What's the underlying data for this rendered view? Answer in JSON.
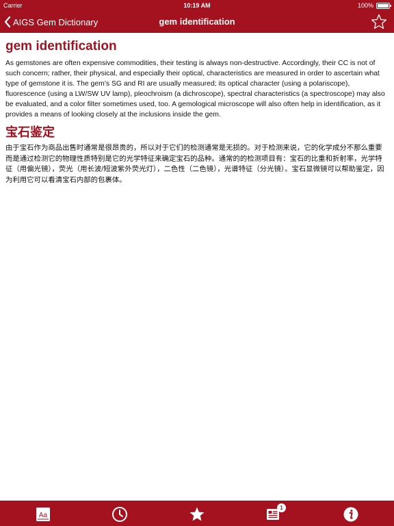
{
  "status_bar": {
    "carrier": "Carrier",
    "time": "10:19 AM",
    "battery": "100%"
  },
  "nav": {
    "back_label": "AIGS Gem Dictionary",
    "title": "gem identification",
    "favorite_icon": "star-outline-icon"
  },
  "entry": {
    "en_term": "gem identification",
    "en_definition": "As gemstones are often expensive commodities, their testing is always non-destructive. Accordingly, their CC is not of such concern; rather, their physical, and especially their optical, characteristics are measured in order to ascertain what type of gemstone it is. The gem’s SG and RI are usually measured; its optical character (using a polariscope), fluorescence (using a LW/SW UV lamp), pleochroism (a dichroscope), spectral characteristics (a spectroscope) may also be evaluated, and a color filter sometimes used, too. A gemological microscope will also often help in identification, as it provides a means of looking closely at the inclusions inside the gem.",
    "zh_term": "宝石鉴定",
    "zh_definition": "由于宝石作为商品出售时通常是很昂贵的，所以对于它们的检测通常是无损的。对于检测来说，它的化学成分不那么重要而是通过检测它的物理性质特别是它的光学特征来确定宝石的品种。通常的的检测项目有：宝石的比重和折射率，光学特征（用偏光镜），荧光（用长波/短波紫外荧光灯），二色性（二色镜），光谱特征（分光镜）。宝石显微镜可以帮助鉴定，因为利用它可以看清宝石内部的包裹体。"
  },
  "tab_bar": {
    "tabs": [
      {
        "icon": "dictionary-icon"
      },
      {
        "icon": "history-clock-icon"
      },
      {
        "icon": "favorites-star-icon"
      },
      {
        "icon": "news-icon",
        "badge": "1"
      },
      {
        "icon": "info-icon"
      }
    ]
  },
  "colors": {
    "brand": "#a3121e",
    "text": "#111111",
    "background": "#ffffff"
  }
}
